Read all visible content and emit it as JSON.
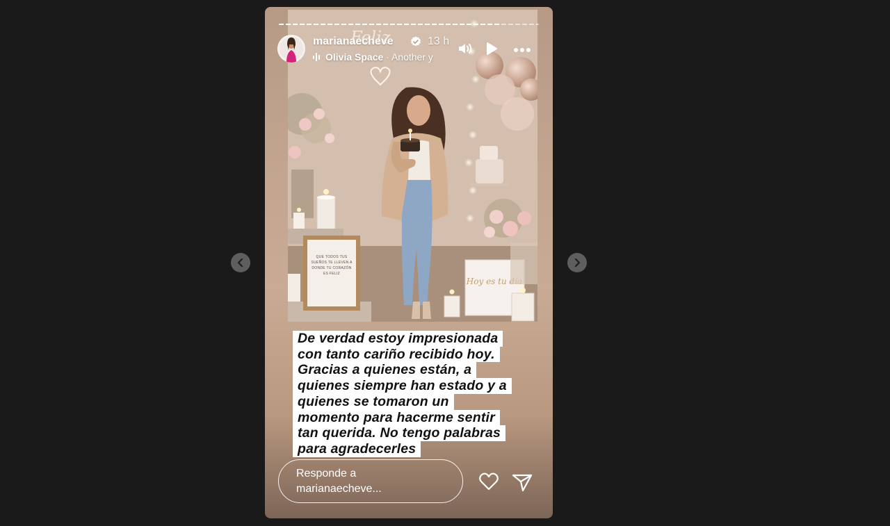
{
  "story": {
    "username": "marianaecheve",
    "time": "13 h",
    "music_artist": "Olivia Space",
    "music_title": "Another y",
    "progress": 0.85
  },
  "caption": [
    "De verdad estoy impresionada",
    "con tanto cariño recibido hoy.",
    "Gracias a quienes están, a",
    "quienes siempre han estado y a",
    "quienes se tomaron un",
    "momento para hacerme sentir",
    "tan querida. No tengo palabras",
    "para agradecerles"
  ],
  "photo_text": {
    "frame": "QUE TODOS TUS SUEÑOS TE LLEVEN A DONDE TU CORAZÓN ES FELIZ",
    "bag": "Hoy es tu día",
    "neon": "Feliz"
  },
  "reply": {
    "placeholder_line1": "Responde a",
    "placeholder_line2": "marianaecheve..."
  },
  "icons": [
    "verified-badge-icon",
    "audio-bars-icon",
    "speaker-icon",
    "play-icon",
    "more-icon",
    "heart-icon",
    "send-icon",
    "chevron-left-icon",
    "chevron-right-icon"
  ],
  "colors": {
    "background": "#1a1a1a",
    "caption_bg": "#ffffff",
    "caption_text": "#111111"
  }
}
